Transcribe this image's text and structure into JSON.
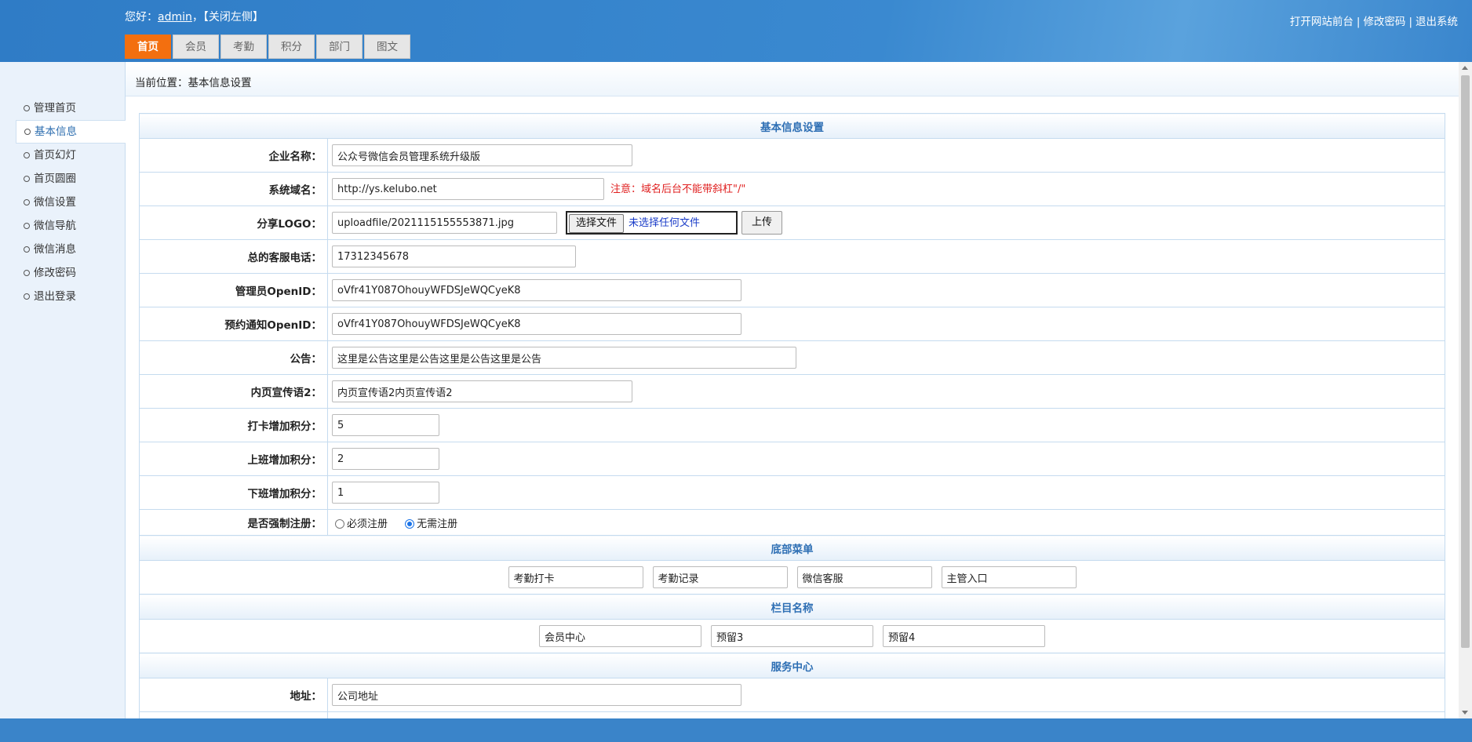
{
  "header": {
    "greeting_prefix": "您好：",
    "user": "admin",
    "greeting_suffix": "，",
    "toggle_sidebar": "【关闭左侧】",
    "links": [
      "打开网站前台",
      "修改密码",
      "退出系统"
    ],
    "tabs": [
      {
        "label": "首页",
        "active": true
      },
      {
        "label": "会员",
        "active": false
      },
      {
        "label": "考勤",
        "active": false
      },
      {
        "label": "积分",
        "active": false
      },
      {
        "label": "部门",
        "active": false
      },
      {
        "label": "图文",
        "active": false
      }
    ]
  },
  "sidebar": {
    "items": [
      {
        "label": "管理首页",
        "active": false
      },
      {
        "label": "基本信息",
        "active": true
      },
      {
        "label": "首页幻灯",
        "active": false
      },
      {
        "label": "首页圆圈",
        "active": false
      },
      {
        "label": "微信设置",
        "active": false
      },
      {
        "label": "微信导航",
        "active": false
      },
      {
        "label": "微信消息",
        "active": false
      },
      {
        "label": "修改密码",
        "active": false
      },
      {
        "label": "退出登录",
        "active": false
      }
    ]
  },
  "breadcrumb": "当前位置：基本信息设置",
  "form": {
    "title": "基本信息设置",
    "company_name": {
      "label": "企业名称：",
      "value": "公众号微信会员管理系统升级版"
    },
    "domain": {
      "label": "系统域名：",
      "value": "http://ys.kelubo.net",
      "note": "注意：域名后台不能带斜杠\"/\""
    },
    "share_logo": {
      "label": "分享LOGO：",
      "value": "uploadfile/2021115155553871.jpg",
      "choose_file": "选择文件",
      "no_file": "未选择任何文件",
      "upload": "上传"
    },
    "phone": {
      "label": "总的客服电话：",
      "value": "17312345678"
    },
    "admin_openid": {
      "label": "管理员OpenID：",
      "value": "oVfr41Y087OhouyWFDSJeWQCyeK8"
    },
    "notify_openid": {
      "label": "预约通知OpenID：",
      "value": "oVfr41Y087OhouyWFDSJeWQCyeK8"
    },
    "notice": {
      "label": "公告：",
      "value": "这里是公告这里是公告这里是公告这里是公告"
    },
    "slogan2": {
      "label": "内页宣传语2：",
      "value": "内页宣传语2内页宣传语2"
    },
    "checkin_points": {
      "label": "打卡增加积分：",
      "value": "5"
    },
    "onduty_points": {
      "label": "上班增加积分：",
      "value": "2"
    },
    "offduty_points": {
      "label": "下班增加积分：",
      "value": "1"
    },
    "force_register": {
      "label": "是否强制注册：",
      "options": [
        "必须注册",
        "无需注册"
      ],
      "selected": "无需注册"
    },
    "bottom_menu": {
      "title": "底部菜单",
      "items": [
        "考勤打卡",
        "考勤记录",
        "微信客服",
        "主管入口"
      ]
    },
    "columns": {
      "title": "栏目名称",
      "items": [
        "会员中心",
        "预留3",
        "预留4"
      ]
    },
    "service": {
      "title": "服务中心"
    },
    "address": {
      "label": "地址：",
      "value": "公司地址"
    }
  }
}
